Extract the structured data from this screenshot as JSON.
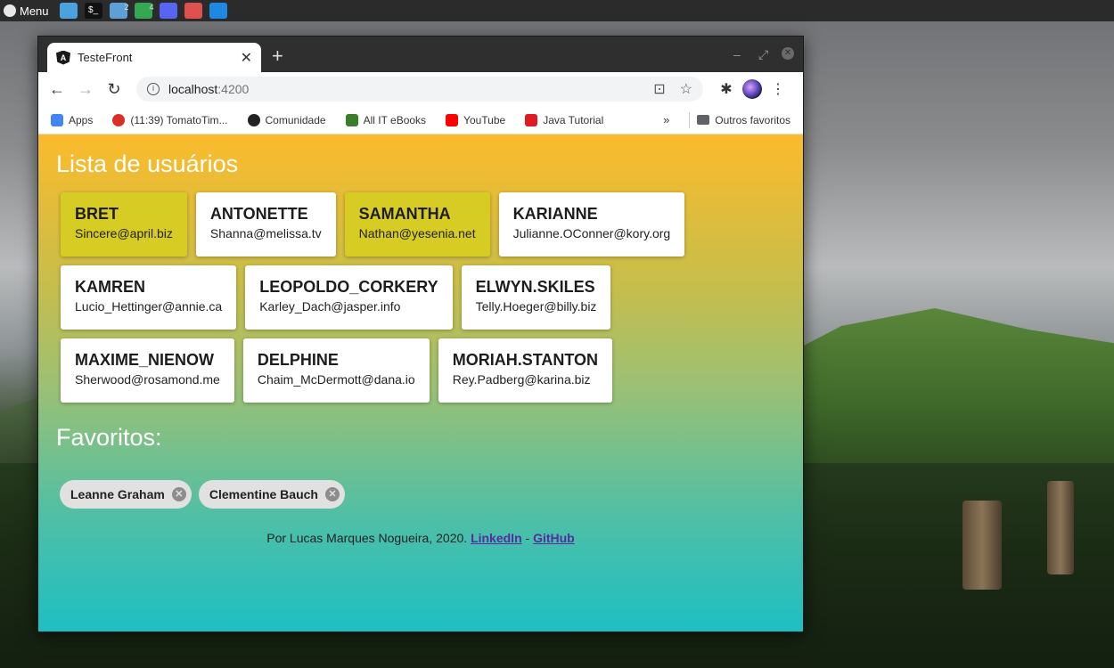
{
  "taskbar": {
    "menu_label": "Menu",
    "icons": [
      {
        "name": "files-icon",
        "color": "#4aa3df",
        "badge": ""
      },
      {
        "name": "terminal-icon",
        "color": "#111111",
        "badge": "",
        "glyph": "$_"
      },
      {
        "name": "folder-icon",
        "color": "#5da0d8",
        "badge": "2"
      },
      {
        "name": "chrome-icon",
        "color": "#34a853",
        "badge": "4"
      },
      {
        "name": "discord-icon",
        "color": "#5865f2",
        "badge": ""
      },
      {
        "name": "reader-icon",
        "color": "#e0504f",
        "badge": ""
      },
      {
        "name": "vscode-icon",
        "color": "#1e88e5",
        "badge": ""
      }
    ]
  },
  "browser": {
    "tab_title": "TesteFront",
    "url_host": "localhost",
    "url_port": ":4200",
    "bookmarks": [
      {
        "label": "Apps",
        "icon": "apps-icon"
      },
      {
        "label": "(11:39) TomatoTim...",
        "icon": "tomato-icon"
      },
      {
        "label": "Comunidade",
        "icon": "community-icon"
      },
      {
        "label": "All IT eBooks",
        "icon": "ebooks-icon"
      },
      {
        "label": "YouTube",
        "icon": "youtube-icon"
      },
      {
        "label": "Java Tutorial",
        "icon": "java-icon"
      }
    ],
    "other_bookmarks": "Outros favoritos"
  },
  "page": {
    "users_title": "Lista de usuários",
    "favorites_title": "Favoritos:",
    "users": [
      {
        "name": "BRET",
        "email": "Sincere@april.biz",
        "favorite": true
      },
      {
        "name": "ANTONETTE",
        "email": "Shanna@melissa.tv",
        "favorite": false
      },
      {
        "name": "SAMANTHA",
        "email": "Nathan@yesenia.net",
        "favorite": true
      },
      {
        "name": "KARIANNE",
        "email": "Julianne.OConner@kory.org",
        "favorite": false
      },
      {
        "name": "KAMREN",
        "email": "Lucio_Hettinger@annie.ca",
        "favorite": false
      },
      {
        "name": "LEOPOLDO_CORKERY",
        "email": "Karley_Dach@jasper.info",
        "favorite": false
      },
      {
        "name": "ELWYN.SKILES",
        "email": "Telly.Hoeger@billy.biz",
        "favorite": false
      },
      {
        "name": "MAXIME_NIENOW",
        "email": "Sherwood@rosamond.me",
        "favorite": false
      },
      {
        "name": "DELPHINE",
        "email": "Chaim_McDermott@dana.io",
        "favorite": false
      },
      {
        "name": "MORIAH.STANTON",
        "email": "Rey.Padberg@karina.biz",
        "favorite": false
      }
    ],
    "favorites": [
      "Leanne Graham",
      "Clementine Bauch"
    ],
    "footer": {
      "text": "Por Lucas Marques Nogueira, 2020.",
      "linkedin": "LinkedIn",
      "separator": "-",
      "github": "GitHub"
    }
  },
  "colors": {
    "favorite_card": "#d7cc24",
    "link": "#5a2aa0"
  }
}
